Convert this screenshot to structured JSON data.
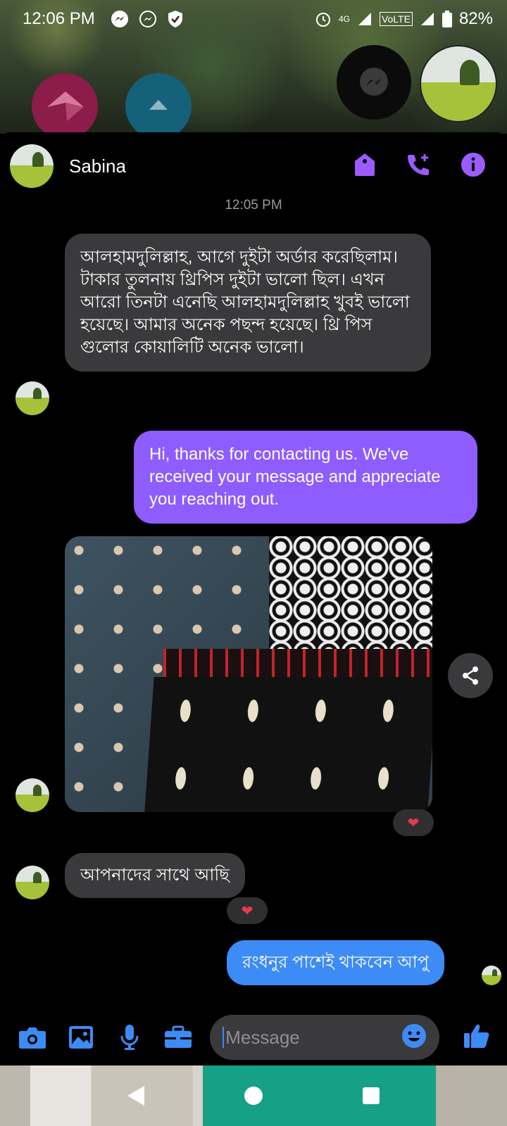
{
  "status_bar": {
    "time": "12:06 PM",
    "network": "4G",
    "volte": "VoLTE",
    "battery": "82%"
  },
  "chat": {
    "contact_name": "Sabina",
    "timestamp": "12:05 PM",
    "messages": [
      {
        "direction": "incoming",
        "text": "আলহামদুলিল্লাহ, আগে দুইটা অর্ডার করেছিলাম। টাকার তুলনায় থ্রিপিস দুইটা ভালো ছিল। এখন আরো তিনটা  এনেছি আলহামদুলিল্লাহ খুবই ভালো হয়েছে। আমার অনেক পছন্দ হয়েছে। থ্রি পিস গুলোর কোয়ালিটি অনেক ভালো।"
      },
      {
        "direction": "outgoing",
        "text": "Hi, thanks for contacting us. We've received your message and appreciate you reaching out."
      },
      {
        "direction": "incoming",
        "type": "photo",
        "reaction": "❤"
      },
      {
        "direction": "incoming",
        "text": "আপনাদের সাথে আছি",
        "reaction": "❤"
      },
      {
        "direction": "outgoing",
        "text": "রংধনুর পাশেই থাকবেন আপু"
      }
    ]
  },
  "composer": {
    "placeholder": "Message"
  },
  "colors": {
    "accent_purple": "#9b5cff",
    "accent_blue": "#3d8bf5",
    "incoming_bubble": "#3a3a3c",
    "outgoing_purple": "#8e5cff",
    "heart": "#e53950"
  },
  "icons": {
    "header": [
      "tag-icon",
      "add-call-icon",
      "info-icon"
    ],
    "composer": [
      "camera-icon",
      "image-icon",
      "microphone-icon",
      "briefcase-icon",
      "emoji-icon",
      "thumbs-up-icon"
    ]
  }
}
